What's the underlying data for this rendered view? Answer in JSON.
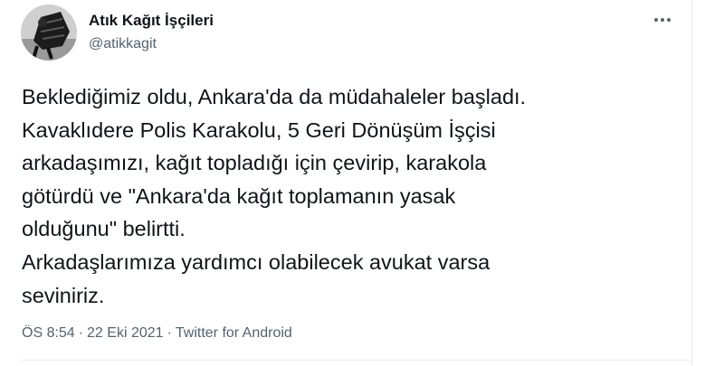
{
  "author": {
    "display_name": "Atık Kağıt İşçileri",
    "handle": "@atikkagit",
    "avatar_icon": "waste-paper-worker-avatar"
  },
  "more_menu": {
    "icon": "more-horizontal-icon"
  },
  "tweet": {
    "lines": [
      "Beklediğimiz oldu, Ankara'da da müdahaleler başladı.",
      "Kavaklıdere Polis Karakolu, 5 Geri Dönüşüm İşçisi",
      "arkadaşımızı, kağıt topladığı için çevirip, karakola",
      "götürdü ve \"Ankara'da kağıt toplamanın yasak",
      "olduğunu\" belirtti.",
      "Arkadaşlarımıza yardımcı olabilecek avukat varsa",
      "seviniriz."
    ]
  },
  "meta": {
    "time": "ÖS 8:54",
    "separator": "·",
    "date": "22 Eki 2021",
    "source": "Twitter for Android"
  },
  "colors": {
    "text": "#0f1419",
    "secondary": "#536471",
    "border": "#e6ecf0"
  }
}
